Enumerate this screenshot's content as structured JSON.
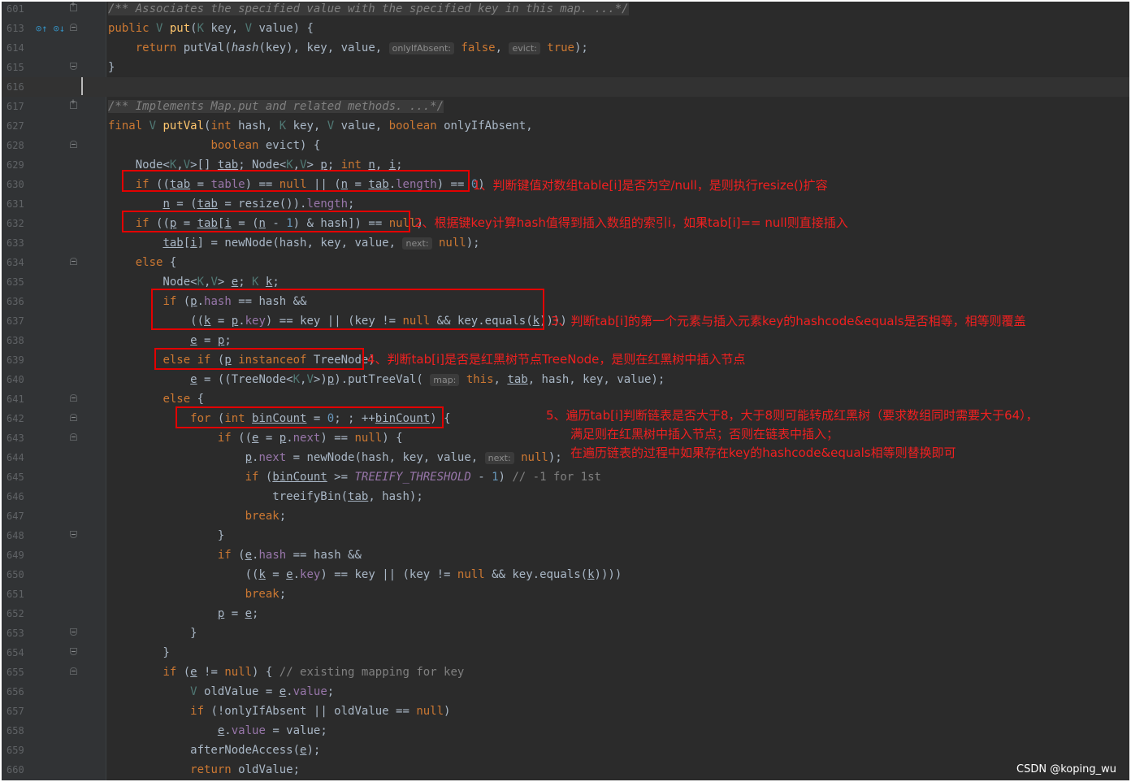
{
  "editor": {
    "lines": [
      {
        "num": "601",
        "segments": [
          {
            "t": "/** Associates the specified value with the specified key in this map. ...*/",
            "c": "cm fold-text"
          }
        ]
      },
      {
        "num": "613",
        "segments": [
          {
            "t": "public ",
            "c": "kw"
          },
          {
            "t": "V ",
            "c": "tp"
          },
          {
            "t": "put",
            "c": "fn"
          },
          {
            "t": "("
          },
          {
            "t": "K ",
            "c": "tp"
          },
          {
            "t": "key, "
          },
          {
            "t": "V ",
            "c": "tp"
          },
          {
            "t": "value) {"
          }
        ]
      },
      {
        "num": "614",
        "segments": [
          {
            "t": "    return ",
            "c": "kw"
          },
          {
            "t": "putVal("
          },
          {
            "t": "hash",
            "c": "it"
          },
          {
            "t": "(key), key, value, "
          },
          {
            "t": "onlyIfAbsent:",
            "c": "hint"
          },
          {
            "t": " false",
            "c": "kw"
          },
          {
            "t": ", "
          },
          {
            "t": "evict:",
            "c": "hint"
          },
          {
            "t": " true",
            "c": "kw"
          },
          {
            "t": ");"
          }
        ]
      },
      {
        "num": "615",
        "segments": [
          {
            "t": "}"
          }
        ]
      },
      {
        "num": "616",
        "segments": [
          {
            "t": ""
          }
        ]
      },
      {
        "num": "617",
        "segments": [
          {
            "t": "/** Implements Map.put and related methods. ...*/",
            "c": "cm fold-text"
          }
        ]
      },
      {
        "num": "627",
        "segments": [
          {
            "t": "final ",
            "c": "kw"
          },
          {
            "t": "V ",
            "c": "tp"
          },
          {
            "t": "putVal",
            "c": "fn"
          },
          {
            "t": "("
          },
          {
            "t": "int ",
            "c": "kw"
          },
          {
            "t": "hash, "
          },
          {
            "t": "K ",
            "c": "tp"
          },
          {
            "t": "key, "
          },
          {
            "t": "V ",
            "c": "tp"
          },
          {
            "t": "value, "
          },
          {
            "t": "boolean ",
            "c": "kw"
          },
          {
            "t": "onlyIfAbsent,"
          }
        ]
      },
      {
        "num": "628",
        "segments": [
          {
            "t": "               "
          },
          {
            "t": "boolean ",
            "c": "kw"
          },
          {
            "t": "evict) {"
          }
        ]
      },
      {
        "num": "629",
        "segments": [
          {
            "t": "    Node<"
          },
          {
            "t": "K",
            "c": "tp"
          },
          {
            "t": ","
          },
          {
            "t": "V",
            "c": "tp"
          },
          {
            "t": ">[] "
          },
          {
            "t": "tab",
            "c": "ul"
          },
          {
            "t": "; Node<"
          },
          {
            "t": "K",
            "c": "tp"
          },
          {
            "t": ","
          },
          {
            "t": "V",
            "c": "tp"
          },
          {
            "t": "> "
          },
          {
            "t": "p",
            "c": "ul"
          },
          {
            "t": "; "
          },
          {
            "t": "int ",
            "c": "kw"
          },
          {
            "t": "n",
            "c": "ul"
          },
          {
            "t": ", "
          },
          {
            "t": "i",
            "c": "ul"
          },
          {
            "t": ";"
          }
        ]
      },
      {
        "num": "630",
        "segments": [
          {
            "t": "    "
          },
          {
            "t": "if ",
            "c": "kw"
          },
          {
            "t": "(("
          },
          {
            "t": "tab",
            "c": "ul"
          },
          {
            "t": " = "
          },
          {
            "t": "table",
            "c": "fld"
          },
          {
            "t": ") == "
          },
          {
            "t": "null ",
            "c": "kw"
          },
          {
            "t": "|| ("
          },
          {
            "t": "n",
            "c": "ul"
          },
          {
            "t": " = "
          },
          {
            "t": "tab",
            "c": "ul"
          },
          {
            "t": "."
          },
          {
            "t": "length",
            "c": "fld"
          },
          {
            "t": ") == "
          },
          {
            "t": "0",
            "c": "num"
          },
          {
            "t": ")"
          }
        ]
      },
      {
        "num": "631",
        "segments": [
          {
            "t": "        "
          },
          {
            "t": "n",
            "c": "ul"
          },
          {
            "t": " = ("
          },
          {
            "t": "tab",
            "c": "ul"
          },
          {
            "t": " = resize())."
          },
          {
            "t": "length",
            "c": "fld"
          },
          {
            "t": ";"
          }
        ]
      },
      {
        "num": "632",
        "segments": [
          {
            "t": "    "
          },
          {
            "t": "if ",
            "c": "kw"
          },
          {
            "t": "(("
          },
          {
            "t": "p",
            "c": "ul"
          },
          {
            "t": " = "
          },
          {
            "t": "tab",
            "c": "ul"
          },
          {
            "t": "["
          },
          {
            "t": "i",
            "c": "ul"
          },
          {
            "t": " = ("
          },
          {
            "t": "n",
            "c": "ul"
          },
          {
            "t": " - "
          },
          {
            "t": "1",
            "c": "num"
          },
          {
            "t": ") & hash]) == "
          },
          {
            "t": "null",
            "c": "kw"
          },
          {
            "t": ")"
          }
        ]
      },
      {
        "num": "633",
        "segments": [
          {
            "t": "        "
          },
          {
            "t": "tab",
            "c": "ul"
          },
          {
            "t": "["
          },
          {
            "t": "i",
            "c": "ul"
          },
          {
            "t": "] = newNode(hash, key, value, "
          },
          {
            "t": "next:",
            "c": "hint"
          },
          {
            "t": " null",
            "c": "kw"
          },
          {
            "t": ");"
          }
        ]
      },
      {
        "num": "634",
        "segments": [
          {
            "t": "    "
          },
          {
            "t": "else ",
            "c": "kw"
          },
          {
            "t": "{"
          }
        ]
      },
      {
        "num": "635",
        "segments": [
          {
            "t": "        Node<"
          },
          {
            "t": "K",
            "c": "tp"
          },
          {
            "t": ","
          },
          {
            "t": "V",
            "c": "tp"
          },
          {
            "t": "> "
          },
          {
            "t": "e",
            "c": "ul"
          },
          {
            "t": "; "
          },
          {
            "t": "K ",
            "c": "tp"
          },
          {
            "t": "k",
            "c": "ul"
          },
          {
            "t": ";"
          }
        ]
      },
      {
        "num": "636",
        "segments": [
          {
            "t": "        "
          },
          {
            "t": "if ",
            "c": "kw"
          },
          {
            "t": "("
          },
          {
            "t": "p",
            "c": "ul"
          },
          {
            "t": "."
          },
          {
            "t": "hash",
            "c": "fld"
          },
          {
            "t": " == hash &&"
          }
        ]
      },
      {
        "num": "637",
        "segments": [
          {
            "t": "            (("
          },
          {
            "t": "k",
            "c": "ul"
          },
          {
            "t": " = "
          },
          {
            "t": "p",
            "c": "ul"
          },
          {
            "t": "."
          },
          {
            "t": "key",
            "c": "fld"
          },
          {
            "t": ") == key || (key != "
          },
          {
            "t": "null ",
            "c": "kw"
          },
          {
            "t": "&& key.equals("
          },
          {
            "t": "k",
            "c": "ul"
          },
          {
            "t": "))))"
          }
        ]
      },
      {
        "num": "638",
        "segments": [
          {
            "t": "            "
          },
          {
            "t": "e",
            "c": "ul"
          },
          {
            "t": " = "
          },
          {
            "t": "p",
            "c": "ul"
          },
          {
            "t": ";"
          }
        ]
      },
      {
        "num": "639",
        "segments": [
          {
            "t": "        "
          },
          {
            "t": "else if ",
            "c": "kw"
          },
          {
            "t": "("
          },
          {
            "t": "p",
            "c": "ul"
          },
          {
            "t": " "
          },
          {
            "t": "instanceof ",
            "c": "kw"
          },
          {
            "t": "TreeNode)"
          }
        ]
      },
      {
        "num": "640",
        "segments": [
          {
            "t": "            "
          },
          {
            "t": "e",
            "c": "ul"
          },
          {
            "t": " = ((TreeNode<"
          },
          {
            "t": "K",
            "c": "tp"
          },
          {
            "t": ","
          },
          {
            "t": "V",
            "c": "tp"
          },
          {
            "t": ">)"
          },
          {
            "t": "p",
            "c": "ul"
          },
          {
            "t": ").putTreeVal( "
          },
          {
            "t": "map:",
            "c": "hint"
          },
          {
            "t": " this",
            "c": "kw"
          },
          {
            "t": ", "
          },
          {
            "t": "tab",
            "c": "ul"
          },
          {
            "t": ", hash, key, value);"
          }
        ]
      },
      {
        "num": "641",
        "segments": [
          {
            "t": "        "
          },
          {
            "t": "else ",
            "c": "kw"
          },
          {
            "t": "{"
          }
        ]
      },
      {
        "num": "642",
        "segments": [
          {
            "t": "            "
          },
          {
            "t": "for ",
            "c": "kw"
          },
          {
            "t": "("
          },
          {
            "t": "int ",
            "c": "kw"
          },
          {
            "t": "binCount",
            "c": "ul"
          },
          {
            "t": " = "
          },
          {
            "t": "0",
            "c": "num"
          },
          {
            "t": "; ; ++"
          },
          {
            "t": "binCount",
            "c": "ul"
          },
          {
            "t": ") {"
          }
        ]
      },
      {
        "num": "643",
        "segments": [
          {
            "t": "                "
          },
          {
            "t": "if ",
            "c": "kw"
          },
          {
            "t": "(("
          },
          {
            "t": "e",
            "c": "ul"
          },
          {
            "t": " = "
          },
          {
            "t": "p",
            "c": "ul"
          },
          {
            "t": "."
          },
          {
            "t": "next",
            "c": "fld"
          },
          {
            "t": ") == "
          },
          {
            "t": "null",
            "c": "kw"
          },
          {
            "t": ") {"
          }
        ]
      },
      {
        "num": "644",
        "segments": [
          {
            "t": "                    "
          },
          {
            "t": "p",
            "c": "ul"
          },
          {
            "t": "."
          },
          {
            "t": "next",
            "c": "fld"
          },
          {
            "t": " = newNode(hash, key, value, "
          },
          {
            "t": "next:",
            "c": "hint"
          },
          {
            "t": " null",
            "c": "kw"
          },
          {
            "t": ");"
          }
        ]
      },
      {
        "num": "645",
        "segments": [
          {
            "t": "                    "
          },
          {
            "t": "if ",
            "c": "kw"
          },
          {
            "t": "("
          },
          {
            "t": "binCount",
            "c": "ul"
          },
          {
            "t": " >= "
          },
          {
            "t": "TREEIFY_THRESHOLD",
            "c": "cst"
          },
          {
            "t": " - "
          },
          {
            "t": "1",
            "c": "num"
          },
          {
            "t": ") "
          },
          {
            "t": "// -1 for 1st",
            "c": "cm"
          }
        ]
      },
      {
        "num": "646",
        "segments": [
          {
            "t": "                        treeifyBin("
          },
          {
            "t": "tab",
            "c": "ul"
          },
          {
            "t": ", hash);"
          }
        ]
      },
      {
        "num": "647",
        "segments": [
          {
            "t": "                    "
          },
          {
            "t": "break",
            "c": "kw"
          },
          {
            "t": ";"
          }
        ]
      },
      {
        "num": "648",
        "segments": [
          {
            "t": "                }"
          }
        ]
      },
      {
        "num": "649",
        "segments": [
          {
            "t": "                "
          },
          {
            "t": "if ",
            "c": "kw"
          },
          {
            "t": "("
          },
          {
            "t": "e",
            "c": "ul"
          },
          {
            "t": "."
          },
          {
            "t": "hash",
            "c": "fld"
          },
          {
            "t": " == hash &&"
          }
        ]
      },
      {
        "num": "650",
        "segments": [
          {
            "t": "                    (("
          },
          {
            "t": "k",
            "c": "ul"
          },
          {
            "t": " = "
          },
          {
            "t": "e",
            "c": "ul"
          },
          {
            "t": "."
          },
          {
            "t": "key",
            "c": "fld"
          },
          {
            "t": ") == key || (key != "
          },
          {
            "t": "null ",
            "c": "kw"
          },
          {
            "t": "&& key.equals("
          },
          {
            "t": "k",
            "c": "ul"
          },
          {
            "t": "))))"
          }
        ]
      },
      {
        "num": "651",
        "segments": [
          {
            "t": "                    "
          },
          {
            "t": "break",
            "c": "kw"
          },
          {
            "t": ";"
          }
        ]
      },
      {
        "num": "652",
        "segments": [
          {
            "t": "                "
          },
          {
            "t": "p",
            "c": "ul"
          },
          {
            "t": " = "
          },
          {
            "t": "e",
            "c": "ul"
          },
          {
            "t": ";"
          }
        ]
      },
      {
        "num": "653",
        "segments": [
          {
            "t": "            }"
          }
        ]
      },
      {
        "num": "654",
        "segments": [
          {
            "t": "        }"
          }
        ]
      },
      {
        "num": "655",
        "segments": [
          {
            "t": "        "
          },
          {
            "t": "if ",
            "c": "kw"
          },
          {
            "t": "("
          },
          {
            "t": "e",
            "c": "ul"
          },
          {
            "t": " != "
          },
          {
            "t": "null",
            "c": "kw"
          },
          {
            "t": ") { "
          },
          {
            "t": "// existing mapping for key",
            "c": "cm"
          }
        ]
      },
      {
        "num": "656",
        "segments": [
          {
            "t": "            "
          },
          {
            "t": "V ",
            "c": "tp"
          },
          {
            "t": "oldValue = "
          },
          {
            "t": "e",
            "c": "ul"
          },
          {
            "t": "."
          },
          {
            "t": "value",
            "c": "fld"
          },
          {
            "t": ";"
          }
        ]
      },
      {
        "num": "657",
        "segments": [
          {
            "t": "            "
          },
          {
            "t": "if ",
            "c": "kw"
          },
          {
            "t": "(!onlyIfAbsent || oldValue == "
          },
          {
            "t": "null",
            "c": "kw"
          },
          {
            "t": ")"
          }
        ]
      },
      {
        "num": "658",
        "segments": [
          {
            "t": "                "
          },
          {
            "t": "e",
            "c": "ul"
          },
          {
            "t": "."
          },
          {
            "t": "value",
            "c": "fld"
          },
          {
            "t": " = value;"
          }
        ]
      },
      {
        "num": "659",
        "segments": [
          {
            "t": "            afterNodeAccess("
          },
          {
            "t": "e",
            "c": "ul"
          },
          {
            "t": ");"
          }
        ]
      },
      {
        "num": "660",
        "segments": [
          {
            "t": "            "
          },
          {
            "t": "return ",
            "c": "kw"
          },
          {
            "t": "oldValue;"
          }
        ]
      }
    ]
  },
  "annotations": {
    "note1": "1、判断键值对数组table[i]是否为空/null，是则执行resize()扩容",
    "note2": "2、根据键key计算hash值得到插入数组的索引i，如果tab[i]== null则直接插入",
    "note3": "3、判断tab[i]的第一个元素与插入元素key的hashcode&equals是否相等，相等则覆盖",
    "note4": "4、判断tab[i]是否是红黑树节点TreeNode，是则在红黑树中插入节点",
    "note5_line1": "5、遍历tab[i]判断链表是否大于8，大于8则可能转成红黑树（要求数组同时需要大于64），",
    "note5_line2": "满足则在红黑树中插入节点；否则在链表中插入；",
    "note5_line3": "在遍历链表的过程中如果存在key的hashcode&equals相等则替换即可"
  },
  "watermark": "CSDN @koping_wu",
  "gutter_icons": "⊙↑ ⊙↓"
}
